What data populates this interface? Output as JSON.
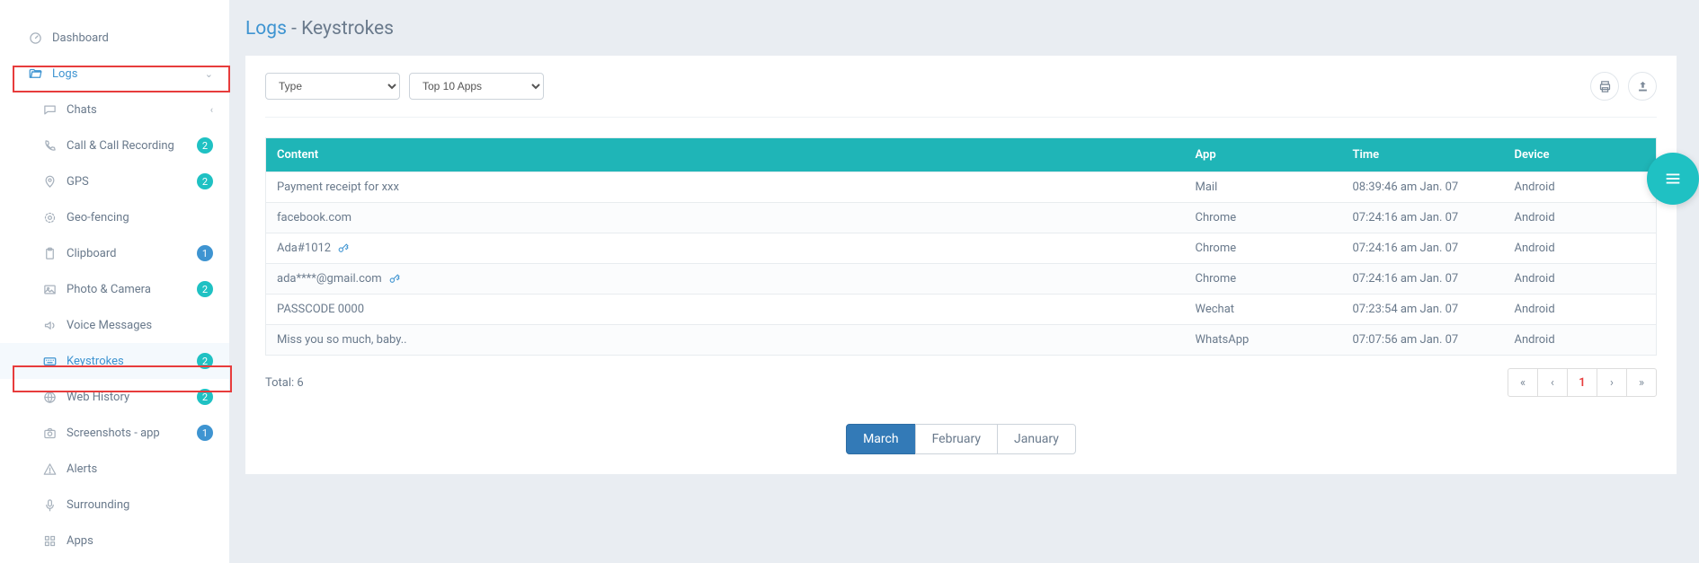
{
  "sidebar": {
    "items": [
      {
        "label": "Dashboard",
        "icon": "dashboard",
        "kind": "top"
      },
      {
        "label": "Logs",
        "icon": "folder-open",
        "kind": "top",
        "style": "logs",
        "tail": "chev-down"
      },
      {
        "label": "Chats",
        "icon": "chats",
        "kind": "nested",
        "tail": "chev-left"
      },
      {
        "label": "Call & Call Recording",
        "icon": "phone",
        "kind": "nested",
        "badge": "2"
      },
      {
        "label": "GPS",
        "icon": "pin",
        "kind": "nested",
        "badge": "2"
      },
      {
        "label": "Geo-fencing",
        "icon": "geofence",
        "kind": "nested"
      },
      {
        "label": "Clipboard",
        "icon": "clipboard",
        "kind": "nested",
        "badge": "1",
        "badgeColor": "blue"
      },
      {
        "label": "Photo & Camera",
        "icon": "image",
        "kind": "nested",
        "badge": "2"
      },
      {
        "label": "Voice Messages",
        "icon": "audio",
        "kind": "nested"
      },
      {
        "label": "Keystrokes",
        "icon": "keyboard",
        "kind": "nested",
        "style": "selected",
        "badge": "2"
      },
      {
        "label": "Web History",
        "icon": "globe",
        "kind": "nested",
        "badge": "2"
      },
      {
        "label": "Screenshots - app",
        "icon": "camera",
        "kind": "nested",
        "badge": "1",
        "badgeColor": "blue"
      },
      {
        "label": "Alerts",
        "icon": "alert",
        "kind": "nested"
      },
      {
        "label": "Surrounding",
        "icon": "mic",
        "kind": "nested"
      },
      {
        "label": "Apps",
        "icon": "apps",
        "kind": "nested"
      }
    ]
  },
  "title": {
    "accent": "Logs",
    "rest": " - Keystrokes"
  },
  "filters": {
    "type": "Type",
    "apps": "Top 10 Apps"
  },
  "columns": {
    "content": "Content",
    "app": "App",
    "time": "Time",
    "device": "Device"
  },
  "rows": [
    {
      "content": "Payment receipt for xxx",
      "app": "Mail",
      "time": "08:39:46 am Jan. 07",
      "device": "Android"
    },
    {
      "content": "facebook.com",
      "app": "Chrome",
      "time": "07:24:16 am Jan. 07",
      "device": "Android"
    },
    {
      "content": "Ada#1012",
      "app": "Chrome",
      "time": "07:24:16 am Jan. 07",
      "device": "Android",
      "key": true
    },
    {
      "content": "ada****@gmail.com",
      "app": "Chrome",
      "time": "07:24:16 am Jan. 07",
      "device": "Android",
      "key": true
    },
    {
      "content": "PASSCODE 0000",
      "app": "Wechat",
      "time": "07:23:54 am Jan. 07",
      "device": "Android"
    },
    {
      "content": "Miss you so much, baby..",
      "app": "WhatsApp",
      "time": "07:07:56 am Jan. 07",
      "device": "Android"
    }
  ],
  "total": "Total: 6",
  "pagination": {
    "first": "«",
    "prev": "‹",
    "page": "1",
    "next": "›",
    "last": "»"
  },
  "months": [
    {
      "label": "March",
      "active": true
    },
    {
      "label": "February"
    },
    {
      "label": "January"
    }
  ]
}
